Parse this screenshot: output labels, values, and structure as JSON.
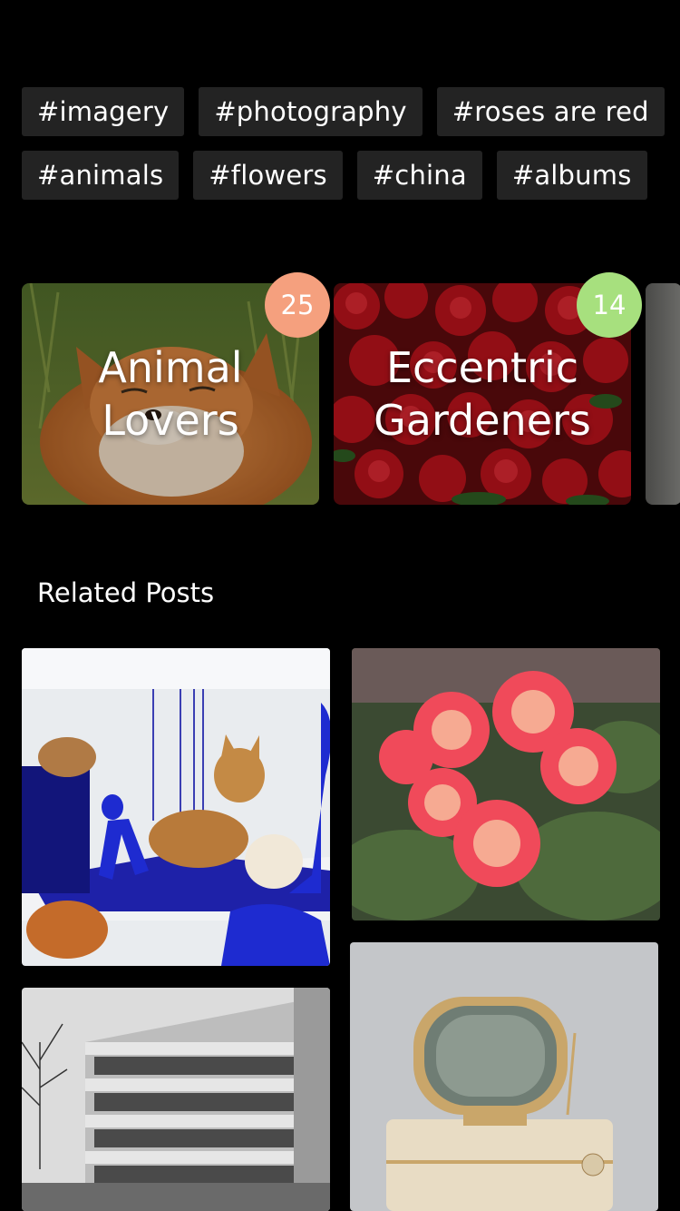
{
  "tags": {
    "row1": [
      "#imagery",
      "#photography",
      "#roses are red"
    ],
    "row2": [
      "#animals",
      "#flowers",
      "#china",
      "#albums"
    ]
  },
  "collections": [
    {
      "title": "Animal\nLovers",
      "count": "25",
      "badge_color": "#f5a07e",
      "image": "fox-photo"
    },
    {
      "title": "Eccentric\nGardeners",
      "count": "14",
      "badge_color": "#a7e07e",
      "image": "roses-photo"
    }
  ],
  "related": {
    "title": "Related Posts",
    "posts": [
      {
        "image": "animals-blue-room-photo"
      },
      {
        "image": "pink-begonias-photo"
      },
      {
        "image": "concrete-building-photo"
      },
      {
        "image": "retro-television-photo"
      }
    ]
  }
}
